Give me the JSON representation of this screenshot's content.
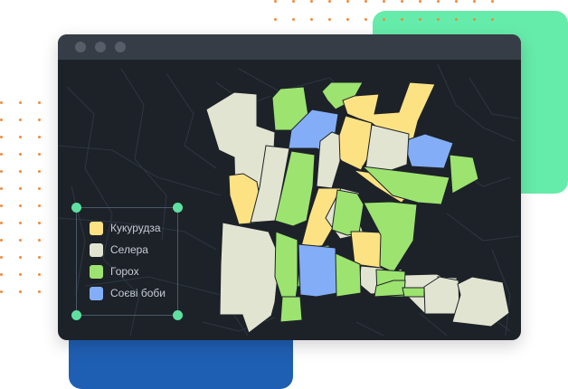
{
  "colors": {
    "corn": "#fde283",
    "celery": "#e2e4d2",
    "peas": "#9de36f",
    "soy": "#83aef7",
    "accent_green": "#66ecaa",
    "accent_blue": "#1f5fb3",
    "window_bg": "#1d2228",
    "titlebar": "#363d47",
    "road": "#2c3540"
  },
  "legend": {
    "items": [
      {
        "label": "Кукурудза",
        "color_key": "corn"
      },
      {
        "label": "Селера",
        "color_key": "celery"
      },
      {
        "label": "Горох",
        "color_key": "peas"
      },
      {
        "label": "Соєві боби",
        "color_key": "soy"
      }
    ]
  },
  "map": {
    "fields": [
      {
        "crop": "celery"
      },
      {
        "crop": "peas"
      },
      {
        "crop": "peas"
      },
      {
        "crop": "soy"
      },
      {
        "crop": "corn"
      },
      {
        "crop": "corn"
      },
      {
        "crop": "celery"
      },
      {
        "crop": "corn"
      },
      {
        "crop": "celery"
      },
      {
        "crop": "soy"
      },
      {
        "crop": "peas"
      },
      {
        "crop": "peas"
      },
      {
        "crop": "celery"
      },
      {
        "crop": "corn"
      },
      {
        "crop": "celery"
      },
      {
        "crop": "peas"
      },
      {
        "crop": "corn"
      },
      {
        "crop": "peas"
      },
      {
        "crop": "celery"
      },
      {
        "crop": "peas"
      },
      {
        "crop": "peas"
      },
      {
        "crop": "corn"
      },
      {
        "crop": "peas"
      },
      {
        "crop": "celery"
      },
      {
        "crop": "peas"
      },
      {
        "crop": "soy"
      },
      {
        "crop": "peas"
      },
      {
        "crop": "celery"
      },
      {
        "crop": "peas"
      },
      {
        "crop": "celery"
      },
      {
        "crop": "peas"
      },
      {
        "crop": "celery"
      },
      {
        "crop": "peas"
      },
      {
        "crop": "celery"
      },
      {
        "crop": "celery"
      }
    ]
  }
}
